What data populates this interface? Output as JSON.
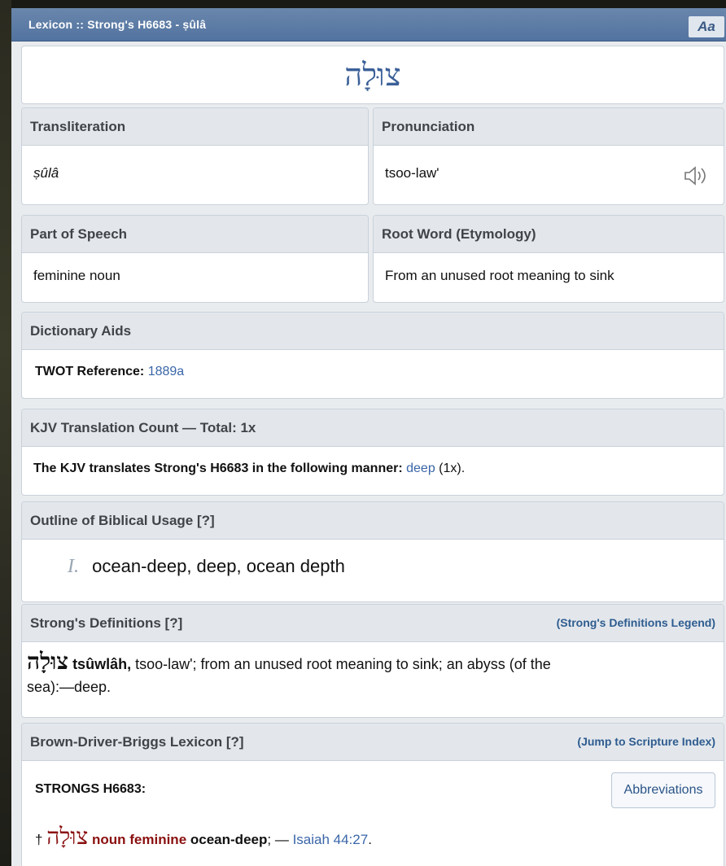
{
  "window": {
    "title": "Lexicon :: Strong's H6683 - ṣûlâ",
    "font_toggle_label": "Aa"
  },
  "word": {
    "hebrew": "צוּלָה"
  },
  "transliteration": {
    "header": "Transliteration",
    "value": "ṣûlâ"
  },
  "pronunciation": {
    "header": "Pronunciation",
    "value": "tsoo-law'",
    "audio_icon": "speaker-icon"
  },
  "part_of_speech": {
    "header": "Part of Speech",
    "value": "feminine noun"
  },
  "root_word": {
    "header": "Root Word (Etymology)",
    "value": "From an unused root meaning to sink"
  },
  "dictionary_aids": {
    "header": "Dictionary Aids",
    "label": "TWOT Reference:",
    "value": "1889a"
  },
  "kjv": {
    "header": "KJV Translation Count — Total: 1x",
    "sentence": "The KJV translates Strong's H6683 in the following manner:",
    "word": "deep",
    "count": "(1x)."
  },
  "outline": {
    "header": "Outline of Biblical Usage [?]",
    "numeral": "I.",
    "text": "ocean-deep, deep, ocean depth"
  },
  "strongs": {
    "header": "Strong's Definitions [?]",
    "legend_link": "(Strong's Definitions Legend)",
    "hebrew": "צוּלָה",
    "translit": "tsûwlâh,",
    "definition_line1": "tsoo-law'; from an unused root meaning to sink; an abyss (of the",
    "definition_line2": "sea):—deep."
  },
  "bdb": {
    "header": "Brown-Driver-Briggs Lexicon [?]",
    "jump_link": "(Jump to Scripture Index)",
    "strongs_label": "STRONGS H6683:",
    "abbreviations_button": "Abbreviations",
    "dagger": "†",
    "hebrew": "צוּלָה",
    "pos": "noun feminine",
    "gloss": "ocean-deep",
    "sep": "; —",
    "reference": "Isaiah 44:27",
    "end": "."
  },
  "colors": {
    "titlebar": "#5b7aa5",
    "header_bg": "#e3e7ec",
    "link": "#3a66a8",
    "maroon": "#8a1010"
  }
}
